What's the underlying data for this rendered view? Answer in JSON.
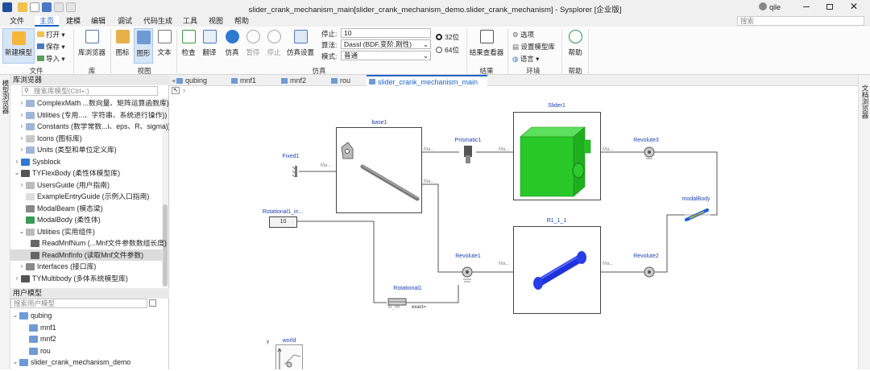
{
  "window": {
    "title": "slider_crank_mechanism_main[slider_crank_mechanism_demo.slider_crank_mechanism] - Sysplorer [企业版]",
    "user": "qile",
    "search_placeholder": "搜索"
  },
  "menu": [
    "文件",
    "主页",
    "建模",
    "编辑",
    "调试",
    "代码生成",
    "工具",
    "视图",
    "帮助"
  ],
  "menu_active": "主页",
  "ribbon": {
    "file": {
      "new_model": "新建模型",
      "open": "打开",
      "save": "保存",
      "import": "导入",
      "group": "文件"
    },
    "library": {
      "browser": "库浏览器",
      "group": "库"
    },
    "view": {
      "icon": "图标",
      "diagram": "图形",
      "text": "文本",
      "group": "视图"
    },
    "simulation": {
      "check": "检查",
      "translate": "翻译",
      "simulate": "仿真",
      "pause": "暂停",
      "stop": "停止",
      "settings": "仿真设置",
      "group": "仿真",
      "stop_time_label": "停止:",
      "stop_time": "10",
      "algorithm_label": "算法:",
      "algorithm": "Dassl (BDF,变阶,刚性)",
      "mode_label": "模式:",
      "mode": "普通",
      "bit32": "32位",
      "bit64": "64位"
    },
    "results": {
      "viewer": "结果查看器",
      "group": "结果"
    },
    "env": {
      "options": "选项",
      "set_lib": "设置模型库",
      "language": "语言",
      "group": "环境"
    },
    "help": {
      "label": "帮助",
      "group": "帮助"
    }
  },
  "left_strip_label": "模型浏览器",
  "library_browser": {
    "title": "库浏览器",
    "search_placeholder": "搜索库模型(Ctrl+:)",
    "items": [
      {
        "label": "ComplexMath ...数向量、矩阵运算函数库)",
        "arrow": "›"
      },
      {
        "label": "Utilities (专用...、字符串、系统进行操作))",
        "arrow": "›"
      },
      {
        "label": "Constants (数学常数...i、eps、R、sigma))",
        "arrow": "›"
      },
      {
        "label": "Icons (图标库)",
        "arrow": "›"
      },
      {
        "label": "Units (类型和单位定义库)",
        "arrow": "›"
      },
      {
        "label": "Sysblock",
        "arrow": "›"
      },
      {
        "label": "TYFlexBody (柔性体模型库)",
        "arrow": "⌄"
      },
      {
        "label": "UsersGuide (用户指南)",
        "arrow": "›"
      },
      {
        "label": "ExampleEntryGuide (示例入口指南)",
        "arrow": ""
      },
      {
        "label": "ModalBeam (模态梁)",
        "arrow": ""
      },
      {
        "label": "ModalBody (柔性体)",
        "arrow": ""
      },
      {
        "label": "Utilities (实用组件)",
        "arrow": "⌄"
      },
      {
        "label": "ReadMnfNum (...Mnf文件参数数组长度)",
        "arrow": ""
      },
      {
        "label": "ReadMnfInfo (读取Mnf文件参数)",
        "arrow": ""
      },
      {
        "label": "Interfaces (接口库)",
        "arrow": "›"
      },
      {
        "label": "TYMultibody (多体系统模型库)",
        "arrow": "›"
      }
    ]
  },
  "user_models": {
    "title": "用户模型",
    "search_placeholder": "搜索用户模型",
    "items": [
      {
        "label": "qubing",
        "arrow": "⌄"
      },
      {
        "label": "mnf1",
        "arrow": ""
      },
      {
        "label": "mnf2",
        "arrow": ""
      },
      {
        "label": "rou",
        "arrow": ""
      },
      {
        "label": "slider_crank_mechanism_demo",
        "arrow": "⌄"
      }
    ]
  },
  "tabs": [
    "qubing",
    "mnf1",
    "mnf2",
    "rou",
    "slider_crank_mechanism_main"
  ],
  "tab_active": "slider_crank_mechanism_main",
  "right_strip_label": "文档浏览器",
  "diagram": {
    "blocks": {
      "base1": "base1",
      "slider1": "Slider1",
      "r1": "R1_1_1",
      "fixed1": "Fixed1",
      "prismatic1": "Prismatic1",
      "revolute3": "Revolute3",
      "revolute1": "Revolute1",
      "revolute2": "Revolute2",
      "modalbody": "modalBody",
      "rotational1_in": "Rotational1_in...",
      "rotational1": "Rotational1",
      "world": "world",
      "const_value": "10",
      "w_ref": "w_ref",
      "exact": "exact=",
      "axis_y": "y",
      "port_ma": "Ma..."
    }
  },
  "colors": {
    "accent": "#1a64c8",
    "slider": "#28c828",
    "rod": "#1e32dc",
    "label_blue": "#1e3fb4"
  }
}
